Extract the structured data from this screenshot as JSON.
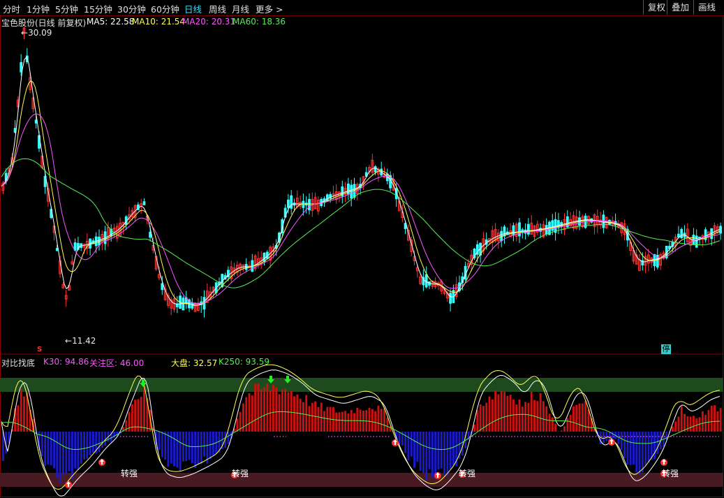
{
  "toolbar": {
    "periods": [
      "分时",
      "1分钟",
      "5分钟",
      "15分钟",
      "30分钟",
      "60分钟",
      "日线",
      "周线",
      "月线",
      "更多 >"
    ],
    "active": "日线",
    "right_buttons": [
      "复权",
      "叠加",
      "画线"
    ]
  },
  "main_panel": {
    "title": "宝色股份(日线 前复权)",
    "ma": [
      {
        "label": "MA5: 22.58",
        "color": "#ffffff"
      },
      {
        "label": "MA10: 21.54",
        "color": "#ffff55"
      },
      {
        "label": "MA20: 20.31",
        "color": "#ff55ff"
      },
      {
        "label": "MA60: 18.36",
        "color": "#55ee55"
      }
    ],
    "high_label": "30.09",
    "low_label": "11.42",
    "stop_badge": "停",
    "s_marker": "S"
  },
  "indicator_panel": {
    "title": "对比找底",
    "k30": "K30: 94.86",
    "focus": "关注区: 46.00",
    "dapan": "大盘: 32.57",
    "k250": "K250: 93.59",
    "signal_text": "转强"
  },
  "colors": {
    "up": "#ff3333",
    "down": "#33ffff",
    "volume_up": "#cc1111",
    "volume_down": "#1a1acc",
    "frame": "#8a0000"
  },
  "chart_data": [
    {
      "type": "candlestick",
      "title": "宝色股份(日线 前复权)",
      "price_range": [
        10,
        32
      ],
      "high": 30.09,
      "low": 11.42,
      "series": [
        {
          "name": "MA5",
          "color": "#ffffff",
          "values": [
            22.58
          ]
        },
        {
          "name": "MA10",
          "color": "#ffff55",
          "values": [
            21.54
          ]
        },
        {
          "name": "MA20",
          "color": "#ff55ff",
          "values": [
            20.31
          ]
        },
        {
          "name": "MA60",
          "color": "#55ee55",
          "values": [
            18.36
          ]
        }
      ]
    },
    {
      "type": "bar",
      "title": "对比找底",
      "series": [
        {
          "name": "K30",
          "values": [
            94.86
          ]
        },
        {
          "name": "关注区",
          "values": [
            46.0
          ]
        },
        {
          "name": "大盘",
          "values": [
            32.57
          ]
        },
        {
          "name": "K250",
          "values": [
            93.59
          ]
        }
      ]
    }
  ]
}
